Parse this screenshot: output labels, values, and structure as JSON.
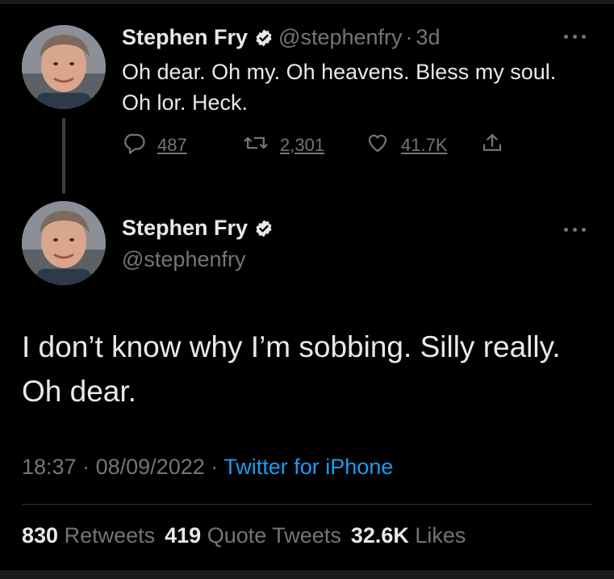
{
  "parent_tweet": {
    "display_name": "Stephen Fry",
    "handle": "@stephenfry",
    "separator": "·",
    "age": "3d",
    "text": "Oh dear. Oh my. Oh heavens. Bless my soul. Oh lor. Heck.",
    "replies": "487",
    "retweets": "2,301",
    "likes": "41.7K"
  },
  "main_tweet": {
    "display_name": "Stephen Fry",
    "handle": "@stephenfry",
    "text": "I don’t know why I’m sobbing. Silly really. Oh dear.",
    "time": "18:37",
    "separator": "·",
    "date": "08/09/2022",
    "source": "Twitter for iPhone",
    "retweet_count": "830",
    "retweet_label": "Retweets",
    "quote_count": "419",
    "quote_label": "Quote Tweets",
    "like_count": "32.6K",
    "like_label": "Likes"
  },
  "colors": {
    "background": "#000000",
    "primary_text": "#e7e9ea",
    "secondary_text": "#71767b",
    "link": "#1d9bf0"
  },
  "icons": [
    "verified-badge-icon",
    "more-icon",
    "reply-icon",
    "retweet-icon",
    "like-icon",
    "share-icon"
  ]
}
